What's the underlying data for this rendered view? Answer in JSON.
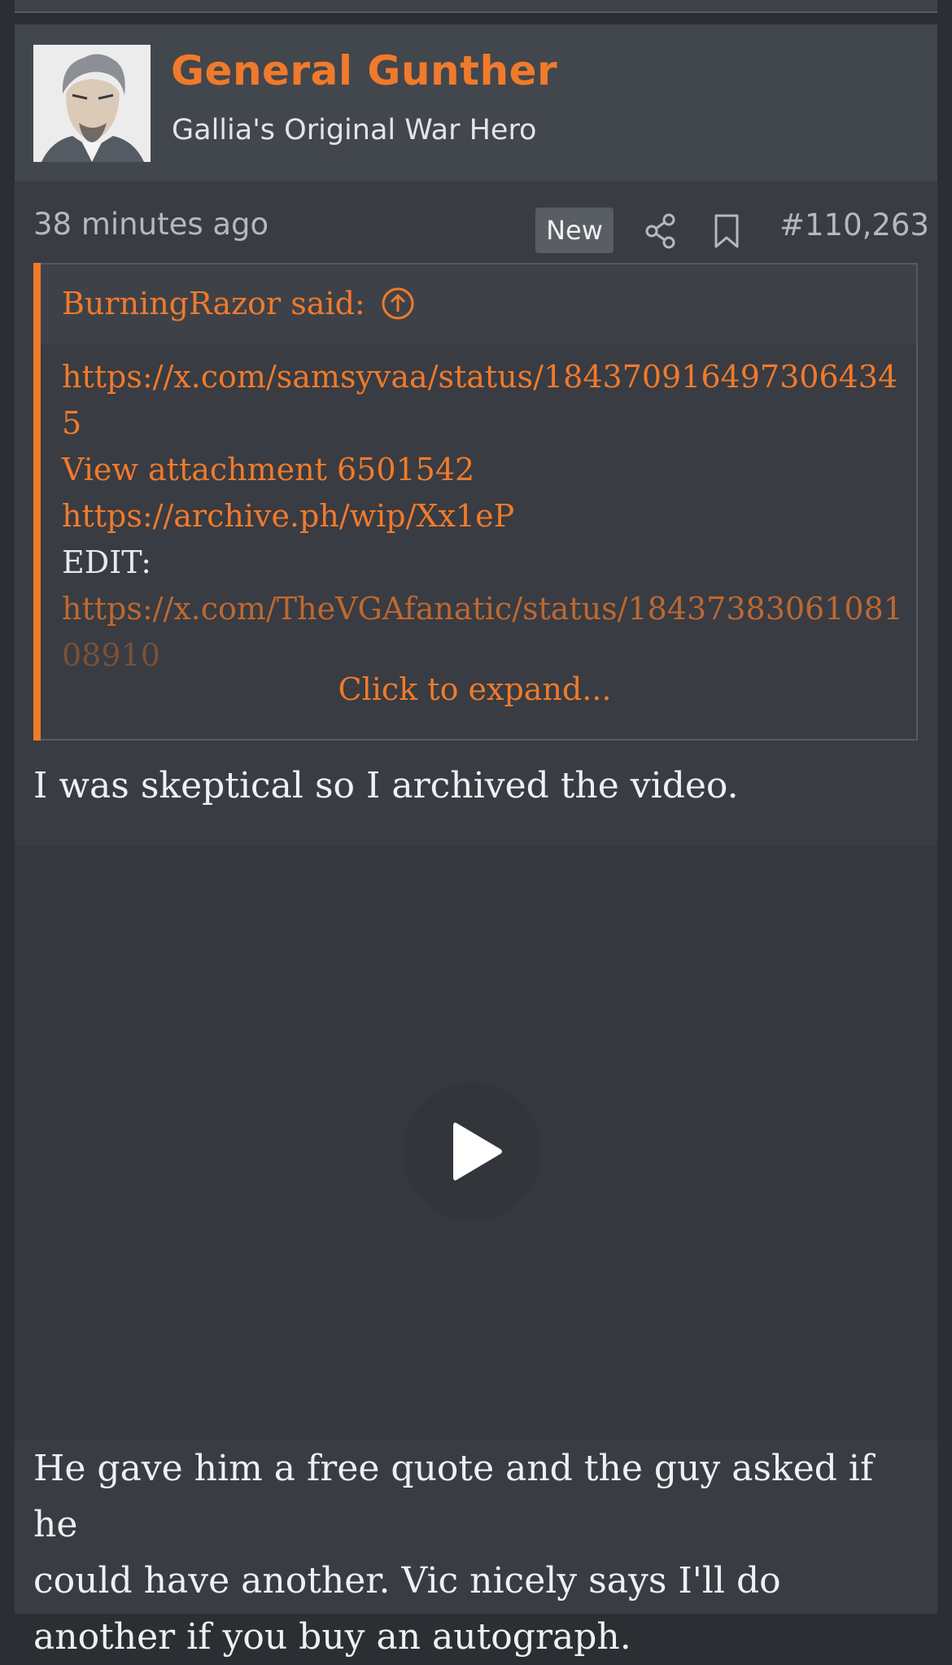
{
  "post": {
    "username": "General Gunther",
    "user_title": "Gallia's Original War Hero",
    "timestamp": "38 minutes ago",
    "new_badge": "New",
    "post_number": "#110,263"
  },
  "quote": {
    "author": "BurningRazor said:",
    "lines": [
      "https://x.com/samsyvaa/status/184370916497306434",
      "5",
      "View attachment 6501542",
      "https://archive.ph/wip/Xx1eP",
      "EDIT:",
      "https://x.com/TheVGAfanatic/status/18437383061081",
      "08910"
    ],
    "expand_label": "Click to expand..."
  },
  "body": {
    "paragraph1": "I was skeptical so I archived the video.",
    "paragraph2_lines": [
      "He gave him a free quote and the guy asked if he",
      "could have another. Vic nicely says I'll do",
      "another if you buy an autograph."
    ]
  },
  "icons": [
    "share-icon",
    "bookmark-icon",
    "arrow-up-circle-icon",
    "play-icon"
  ],
  "colors": {
    "accent": "#f07a2b",
    "background": "#393c42",
    "header_background": "#42464d"
  }
}
